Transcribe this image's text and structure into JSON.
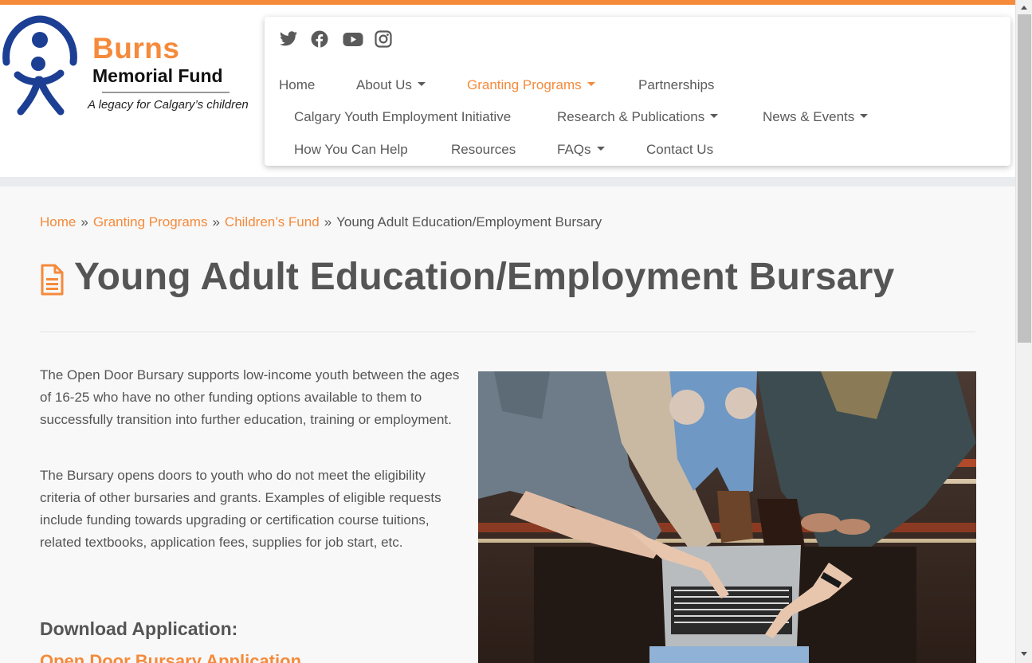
{
  "logo": {
    "title": "Burns",
    "subtitle": "Memorial Fund",
    "tagline": "A legacy for Calgary’s children"
  },
  "social": [
    "twitter-icon",
    "facebook-icon",
    "youtube-icon",
    "instagram-icon"
  ],
  "nav": {
    "home": "Home",
    "about": "About Us",
    "granting": "Granting Programs",
    "partnerships": "Partnerships",
    "cyei": "Calgary Youth Employment Initiative",
    "research": "Research & Publications",
    "news": "News & Events",
    "help": "How You Can Help",
    "resources": "Resources",
    "faqs": "FAQs",
    "contact": "Contact Us"
  },
  "breadcrumb": {
    "home": "Home",
    "granting": "Granting Programs",
    "childrens_fund": "Children’s Fund",
    "current": "Young Adult Education/Employment Bursary",
    "separator": "»"
  },
  "page": {
    "title": "Young Adult Education/Employment Bursary",
    "para1": "The Open Door Bursary supports low-income youth between the ages of 16-25 who have no other funding options available to them to successfully transition into further education, training or employment.",
    "para2": "The Bursary opens doors to youth who do not meet the eligibility criteria of other bursaries and grants. Examples of eligible requests include funding towards upgrading or certification course tuitions, related textbooks, application fees, supplies for job start, etc.",
    "download_heading": "Download Application:",
    "download_link": "Open Door Bursary Application"
  },
  "colors": {
    "accent": "#f58a3b",
    "text": "#555555",
    "logo_blue": "#1c3f94"
  }
}
